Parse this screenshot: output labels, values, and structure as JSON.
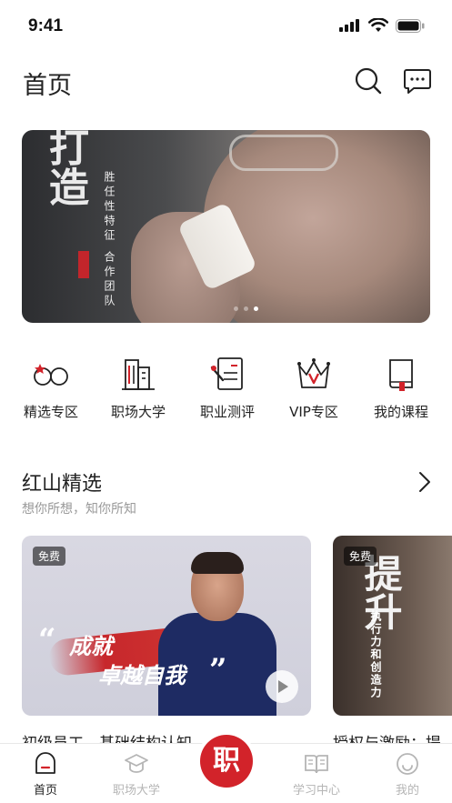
{
  "status_bar": {
    "time": "9:41"
  },
  "header": {
    "title": "首页"
  },
  "banner": {
    "calligraphy_big": "打造",
    "calligraphy_small": "胜任性特征 合作团队",
    "slide_count": 3,
    "active_slide": 3
  },
  "categories": [
    {
      "label": "精选专区",
      "icon": "featured-icon"
    },
    {
      "label": "职场大学",
      "icon": "university-icon"
    },
    {
      "label": "职业测评",
      "icon": "assessment-icon"
    },
    {
      "label": "VIP专区",
      "icon": "vip-crown-icon"
    },
    {
      "label": "我的课程",
      "icon": "book-icon"
    }
  ],
  "section": {
    "title": "红山精选",
    "subtitle": "想你所想，知你所知"
  },
  "cards": [
    {
      "badge": "免费",
      "slogan_line1": "成就",
      "slogan_line2": "卓越自我",
      "quote_open": "“",
      "quote_close": "”",
      "title": "初级员工—基础结构认知"
    },
    {
      "badge": "免费",
      "big_text": "提升",
      "small_text": "执行力和创造力",
      "title": "授权与激励：提"
    }
  ],
  "tabbar": {
    "tabs": [
      {
        "label": "首页",
        "active": true
      },
      {
        "label": "职场大学",
        "active": false
      },
      {
        "label": "学习中心",
        "active": false
      },
      {
        "label": "我的",
        "active": false
      }
    ],
    "center": "职"
  },
  "colors": {
    "brand_red": "#d2232a",
    "text": "#222222",
    "muted": "#9a9a9a"
  }
}
